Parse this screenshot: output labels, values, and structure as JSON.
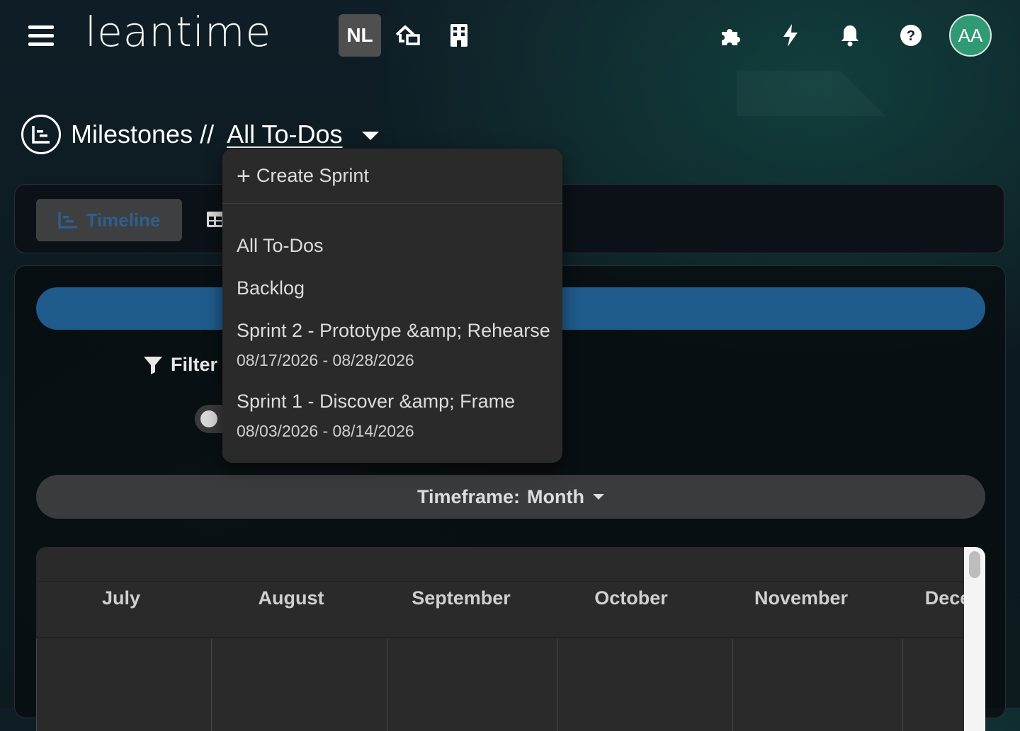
{
  "header": {
    "logo": "leantime",
    "project_initials": "NL",
    "avatar_initials": "AA",
    "icons": [
      "menu-icon",
      "home-icon",
      "building-icon",
      "puzzle-icon",
      "bolt-icon",
      "bell-icon",
      "help-icon"
    ]
  },
  "page": {
    "title": "Milestones //",
    "current_view": "All To-Dos"
  },
  "tabs": {
    "timeline_label": "Timeline"
  },
  "filter": {
    "label": "Filter"
  },
  "timeframe": {
    "label": "Timeframe:",
    "value": "Month"
  },
  "gantt": {
    "months": [
      "July",
      "August",
      "September",
      "October",
      "November",
      "December"
    ]
  },
  "dropdown": {
    "create_label": "Create Sprint",
    "items": [
      {
        "label": "All To-Dos"
      },
      {
        "label": "Backlog"
      },
      {
        "label": "Sprint 2 - Prototype &amp; Rehearse",
        "dates": "08/17/2026 - 08/28/2026"
      },
      {
        "label": "Sprint 1 - Discover &amp; Frame",
        "dates": "08/03/2026 - 08/14/2026"
      }
    ]
  },
  "colors": {
    "accent_blue": "#1f5b8c",
    "avatar_green": "#2f9a73",
    "panel_dark": "#0b1116"
  }
}
